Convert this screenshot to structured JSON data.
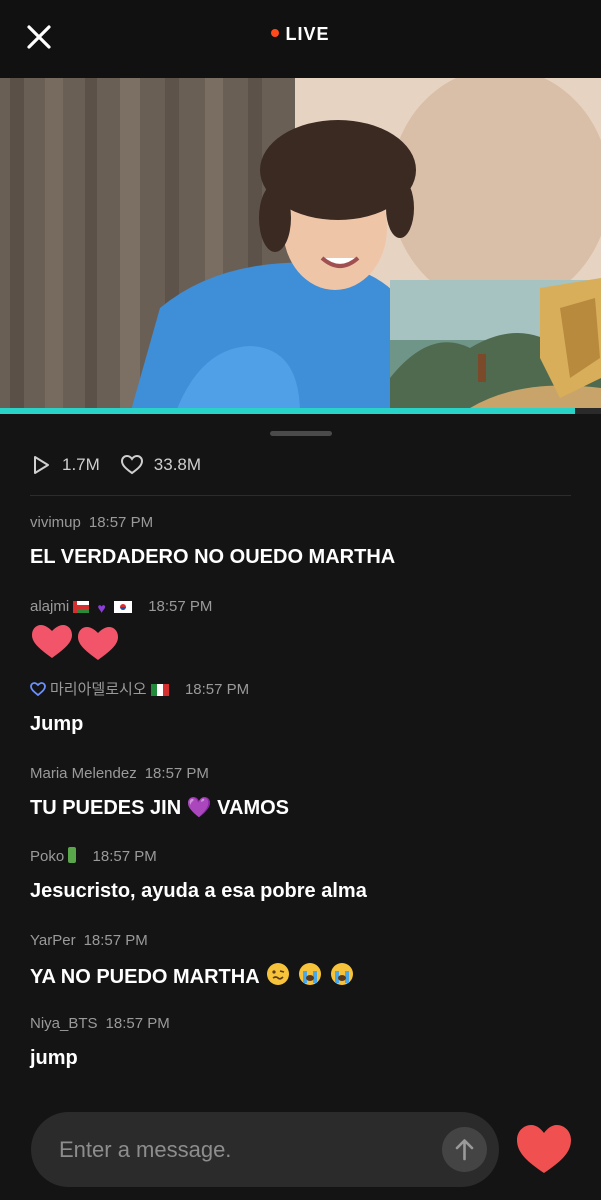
{
  "header": {
    "live_label": "LIVE"
  },
  "video": {
    "progress": 0.957
  },
  "stats": {
    "plays": "1.7M",
    "likes": "33.8M"
  },
  "comments": [
    {
      "user": "vivimup",
      "time": "18:57 PM",
      "text": "EL VERDADERO NO OUEDO MARTHA"
    },
    {
      "user": "alajmi",
      "time": "18:57 PM",
      "text": ""
    },
    {
      "user": "마리아델로시오",
      "time": "18:57 PM",
      "text": "Jump"
    },
    {
      "user": "Maria Melendez",
      "time": "18:57 PM",
      "text": "TU PUEDES JIN 💜  VAMOS"
    },
    {
      "user": "Poko",
      "time": "18:57 PM",
      "text": "Jesucristo, ayuda a esa pobre alma"
    },
    {
      "user": "YarPer",
      "time": "18:57 PM",
      "text": "YA NO PUEDO MARTHA"
    },
    {
      "user": "Niya_BTS",
      "time": "18:57 PM",
      "text": "jump"
    }
  ],
  "composer": {
    "placeholder": "Enter a message."
  },
  "colors": {
    "accent_live": "#ff4a1c",
    "progress": "#2ad3c7",
    "like_heart": "#f0504f"
  }
}
